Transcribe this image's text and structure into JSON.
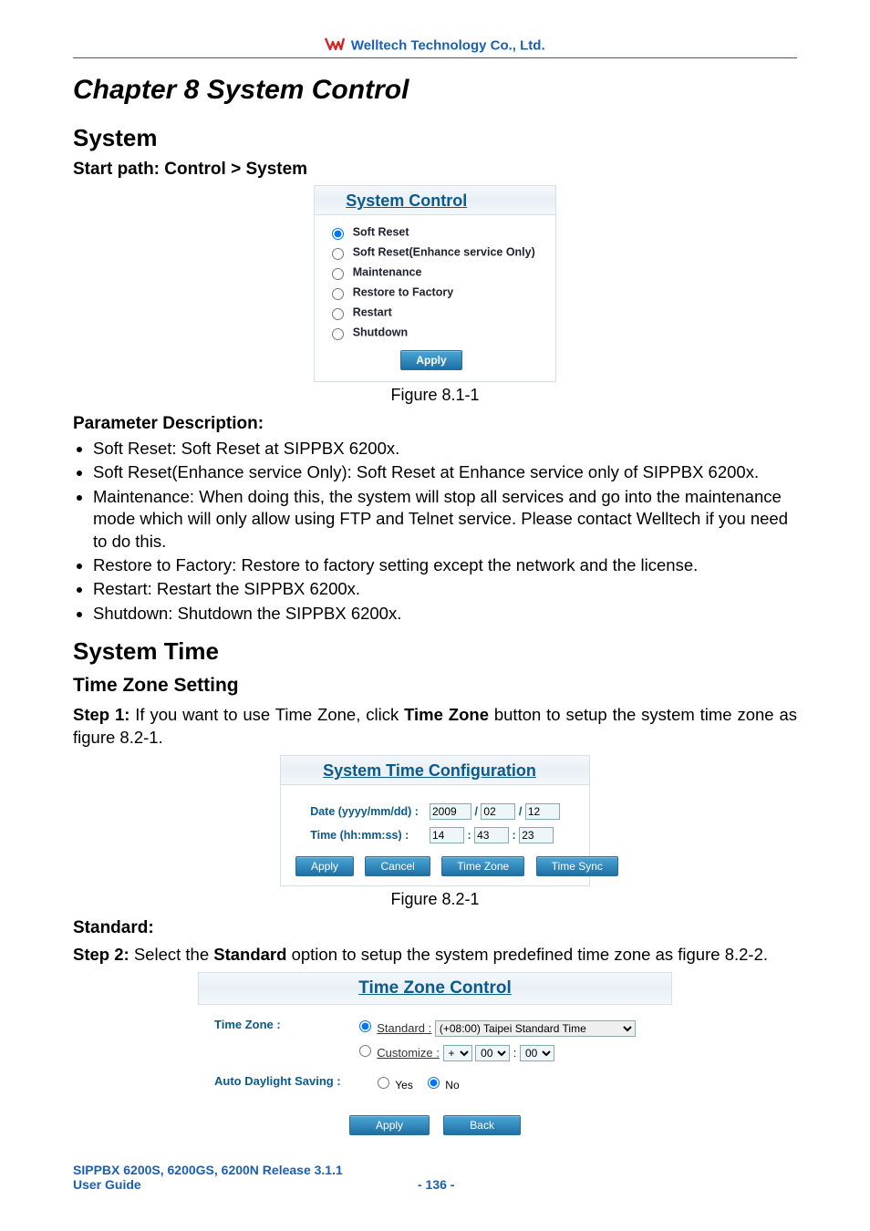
{
  "header": {
    "brand": "Welltech Technology Co., Ltd."
  },
  "chapter": "Chapter 8 System Control",
  "sections": {
    "system": "System",
    "start_path": "Start path: Control > System",
    "system_time": "System Time",
    "time_zone": "Time Zone Setting"
  },
  "panel1": {
    "title": "System Control",
    "options": [
      "Soft Reset",
      "Soft Reset(Enhance service Only)",
      "Maintenance",
      "Restore to Factory",
      "Restart",
      "Shutdown"
    ],
    "selected_index": 0,
    "apply_btn": "Apply",
    "fig": "Figure 8.1-1"
  },
  "param_title": "Parameter Description:",
  "bullets": [
    "Soft Reset: Soft Reset at SIPPBX 6200x.",
    "Soft Reset(Enhance service Only): Soft Reset at Enhance service only of SIPPBX 6200x.",
    "Maintenance: When doing this, the system will stop all services and go into the maintenance mode which will only allow using FTP and Telnet service. Please contact Welltech if you need to do this.",
    "Restore to Factory: Restore to factory setting except the network and the license.",
    "Restart: Restart the SIPPBX 6200x.",
    "Shutdown: Shutdown the SIPPBX 6200x."
  ],
  "step1": {
    "prefix": "Step 1:",
    "text_a": " If you want to use Time Zone, click ",
    "bold": "Time Zone",
    "text_b": " button to setup the system time zone as figure 8.2-1."
  },
  "panel2": {
    "title": "System Time Configuration",
    "date_label": "Date (yyyy/mm/dd) :",
    "date": {
      "y": "2009",
      "m": "02",
      "d": "12"
    },
    "time_label": "Time (hh:mm:ss) :",
    "time": {
      "h": "14",
      "m": "43",
      "s": "23"
    },
    "buttons": [
      "Apply",
      "Cancel",
      "Time Zone",
      "Time Sync"
    ],
    "fig": "Figure 8.2-1"
  },
  "standard_label": "Standard:",
  "step2": {
    "prefix": "Step 2:",
    "text_a": " Select the ",
    "bold": "Standard",
    "text_b": " option to setup the system predefined time zone as figure 8.2-2."
  },
  "panel3": {
    "title": "Time Zone Control",
    "tz_label": "Time Zone :",
    "std_label": "Standard :",
    "std_value": "(+08:00) Taipei Standard Time",
    "cust_label": "Customize :",
    "cust_sign": "+",
    "cust_hh": "00",
    "cust_mm": "00",
    "auto_label": "Auto Daylight Saving :",
    "yes": "Yes",
    "no": "No",
    "auto_selected": "No",
    "buttons": [
      "Apply",
      "Back"
    ]
  },
  "footer": {
    "left1": "SIPPBX 6200S, 6200GS, 6200N Release 3.1.1",
    "left2": "User Guide",
    "page": "- 136 -"
  }
}
